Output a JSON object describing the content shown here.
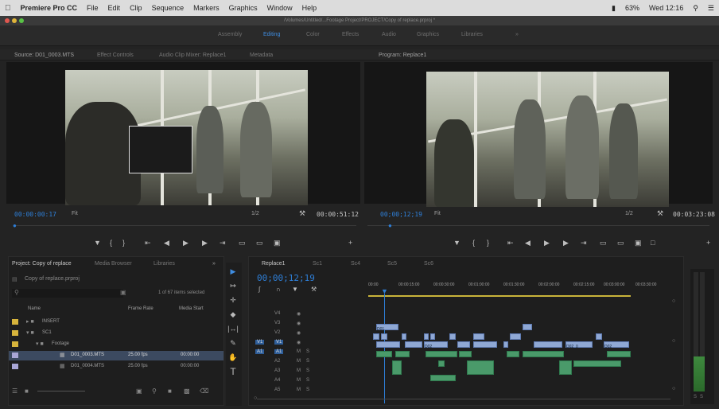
{
  "menubar": {
    "app": "Premiere Pro CC",
    "items": [
      "File",
      "Edit",
      "Clip",
      "Sequence",
      "Markers",
      "Graphics",
      "Window",
      "Help"
    ],
    "battery": "63%",
    "clock": "Wed 12:16"
  },
  "window": {
    "title": "/Volumes/Untitled/...Footage Project/PROJECT/Copy of replace.prproj *"
  },
  "workspaces": [
    "Assembly",
    "Editing",
    "Color",
    "Effects",
    "Audio",
    "Graphics",
    "Libraries"
  ],
  "source": {
    "tabs": [
      "Source: D01_0003.MTS",
      "Effect Controls",
      "Audio Clip Mixer: Replace1",
      "Metadata"
    ],
    "timecode": "00:00:00:17",
    "fit": "Fit",
    "scale": "1/2",
    "duration": "00:00:51:12"
  },
  "program": {
    "tab": "Program: Replace1",
    "timecode": "00;00;12;19",
    "fit": "Fit",
    "scale": "1/2",
    "duration": "00:03:23:08"
  },
  "project": {
    "tabs": [
      "Project: Copy of replace",
      "Media Browser",
      "Libraries"
    ],
    "file": "Copy of replace.prproj",
    "selection": "1 of 67 items selected",
    "columns": [
      "Name",
      "Frame Rate",
      "Media Start"
    ],
    "rows": [
      {
        "name": "INSERT",
        "rate": "",
        "start": ""
      },
      {
        "name": "SC1",
        "rate": "",
        "start": ""
      },
      {
        "name": "Footage",
        "rate": "",
        "start": ""
      },
      {
        "name": "D01_0003.MTS",
        "rate": "25.00 fps",
        "start": "00:00:00"
      },
      {
        "name": "D01_0004.MTS",
        "rate": "25.00 fps",
        "start": "00:00:00"
      }
    ]
  },
  "timeline": {
    "tabs": [
      "Replace1",
      "Sc1",
      "Sc4",
      "Sc5",
      "Sc6"
    ],
    "timecode": "00;00;12;19",
    "ruler": [
      "00:00",
      "00:00:15:00",
      "00:00:30:00",
      "00:01:00:00",
      "00:01:30:00",
      "00:02:00:00",
      "00:02:15:00",
      "00:03:00:00",
      "00:03:30:00"
    ],
    "tracks": [
      "V4",
      "V3",
      "V2",
      "V1",
      "A1",
      "A2",
      "A3",
      "A4",
      "A5"
    ],
    "clip_labels": [
      "D01",
      "D02",
      "D02_0",
      "D02"
    ]
  },
  "colors": {
    "accent": "#2e7fd8",
    "video_clip": "#8fa8d4",
    "audio_clip": "#4a9a6a",
    "label_yellow": "#d7b43c",
    "label_lavender": "#a9a6d6"
  }
}
